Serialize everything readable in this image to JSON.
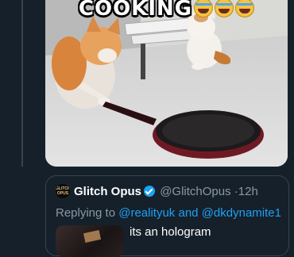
{
  "media": {
    "caption": "COOKING",
    "emoji_icons": [
      "rolling-on-floor-laughing-emoji",
      "rolling-on-floor-laughing-emoji",
      "rolling-on-floor-laughing-emoji"
    ]
  },
  "quoted_tweet": {
    "avatar_text": "GLITCH OPUS",
    "display_name": "Glitch Opus",
    "verified": true,
    "handle": "@GlitchOpus",
    "separator": "·",
    "time": "12h",
    "replying_prefix": "Replying to",
    "mention_1": "@realityuk",
    "conjunction": "and",
    "mention_2": "@dkdynamite1",
    "text": "its an hologram"
  },
  "colors": {
    "background": "#15202b",
    "border": "#38444d",
    "muted_text": "#8899a6",
    "accent": "#1da1f2",
    "pan": "#7a1e28"
  }
}
